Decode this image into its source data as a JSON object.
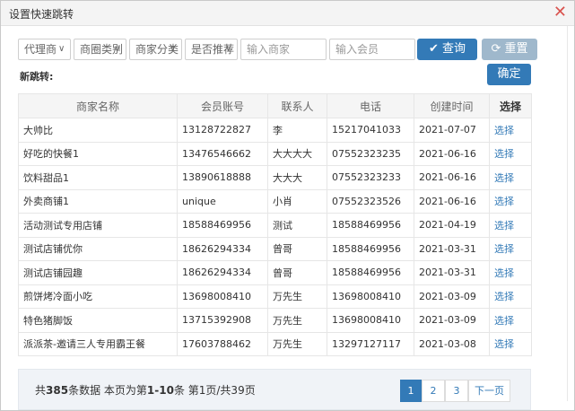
{
  "dialog": {
    "title": "设置快速跳转",
    "close_glyph": "✕"
  },
  "filters": {
    "agent": "代理商",
    "district": "商圈类别",
    "category": "商家分类",
    "recommend": "是否推荐",
    "merchant_placeholder": "输入商家",
    "member_placeholder": "输入会员",
    "query_label": "查询",
    "reset_label": "重置"
  },
  "jump_label": "新跳转:",
  "confirm_label": "确定",
  "table": {
    "headers": [
      "商家名称",
      "会员账号",
      "联系人",
      "电话",
      "创建时间",
      "选择"
    ],
    "rows": [
      [
        "大帅比",
        "13128722827",
        "李",
        "15217041033",
        "2021-07-07",
        "选择"
      ],
      [
        "好吃的快餐1",
        "13476546662",
        "大大大大",
        "07552323235",
        "2021-06-16",
        "选择"
      ],
      [
        "饮料甜品1",
        "13890618888",
        "大大大",
        "07552323233",
        "2021-06-16",
        "选择"
      ],
      [
        "外卖商铺1",
        "unique",
        "小肖",
        "07552323526",
        "2021-06-16",
        "选择"
      ],
      [
        "活动测试专用店铺",
        "18588469956",
        "测试",
        "18588469956",
        "2021-04-19",
        "选择"
      ],
      [
        "测试店铺优你",
        "18626294334",
        "曾哥",
        "18588469956",
        "2021-03-31",
        "选择"
      ],
      [
        "测试店铺园趣",
        "18626294334",
        "曾哥",
        "18588469956",
        "2021-03-31",
        "选择"
      ],
      [
        "煎饼烤冷面小吃",
        "13698008410",
        "万先生",
        "13698008410",
        "2021-03-09",
        "选择"
      ],
      [
        "特色猪脚饭",
        "13715392908",
        "万先生",
        "13698008410",
        "2021-03-09",
        "选择"
      ],
      [
        "派派茶-邀请三人专用霸王餐",
        "17603788462",
        "万先生",
        "13297127117",
        "2021-03-08",
        "选择"
      ]
    ]
  },
  "footer": {
    "prefix": "共",
    "total": "385",
    "mid": "条数据  本页为第",
    "range": "1-10",
    "suffix": "条  第1页/共39页",
    "pages": [
      "1",
      "2",
      "3"
    ],
    "next_label": "下一页",
    "current_page": "1"
  },
  "colors": {
    "primary": "#337ab7",
    "reset": "#9fb8cc",
    "close": "#d9534f"
  },
  "icons": {
    "query": "check-icon",
    "reset": "refresh-icon",
    "close": "close-icon",
    "dropdown": "chevron-down-icon"
  }
}
